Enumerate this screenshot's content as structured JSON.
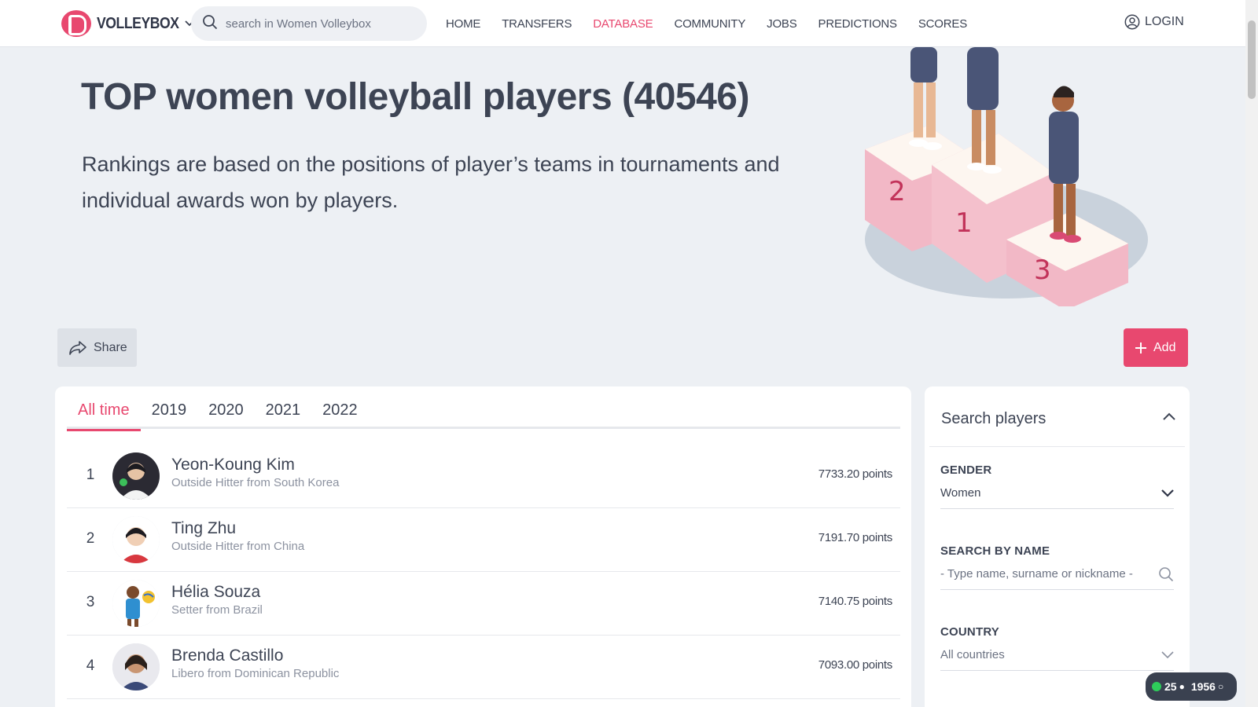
{
  "header": {
    "logo_text": "VOLLEYBOX",
    "search_placeholder": "search in Women Volleybox",
    "nav": [
      {
        "label": "HOME",
        "active": false
      },
      {
        "label": "TRANSFERS",
        "active": false
      },
      {
        "label": "DATABASE",
        "active": true
      },
      {
        "label": "COMMUNITY",
        "active": false
      },
      {
        "label": "JOBS",
        "active": false
      },
      {
        "label": "PREDICTIONS",
        "active": false
      },
      {
        "label": "SCORES",
        "active": false
      }
    ],
    "login_label": "LOGIN"
  },
  "hero": {
    "title": "TOP women volleyball players (40546)",
    "description": "Rankings are based on the positions of player’s teams in tournaments and individual awards won by players.",
    "podium_numbers": [
      "2",
      "1",
      "3"
    ]
  },
  "actions": {
    "share_label": "Share",
    "add_label": "Add"
  },
  "ranking": {
    "tabs": [
      {
        "label": "All time",
        "active": true
      },
      {
        "label": "2019",
        "active": false
      },
      {
        "label": "2020",
        "active": false
      },
      {
        "label": "2021",
        "active": false
      },
      {
        "label": "2022",
        "active": false
      }
    ],
    "players": [
      {
        "rank": "1",
        "name": "Yeon-Koung Kim",
        "info": "Outside Hitter from South Korea",
        "points": "7733.20 points"
      },
      {
        "rank": "2",
        "name": "Ting Zhu",
        "info": "Outside Hitter from China",
        "points": "7191.70 points"
      },
      {
        "rank": "3",
        "name": "Hélia Souza",
        "info": "Setter from Brazil",
        "points": "7140.75 points"
      },
      {
        "rank": "4",
        "name": "Brenda Castillo",
        "info": "Libero from Dominican Republic",
        "points": "7093.00 points"
      }
    ]
  },
  "sidebar": {
    "title": "Search players",
    "gender_label": "GENDER",
    "gender_value": "Women",
    "name_label": "SEARCH BY NAME",
    "name_placeholder": "- Type name, surname or nickname -",
    "country_label": "COUNTRY",
    "country_value": "All countries"
  },
  "online_widget": {
    "count_a": "25",
    "count_b": "1956"
  },
  "colors": {
    "accent": "#e8486f",
    "text": "#3d4454",
    "muted": "#8c92a0",
    "background": "#edf0f4"
  }
}
